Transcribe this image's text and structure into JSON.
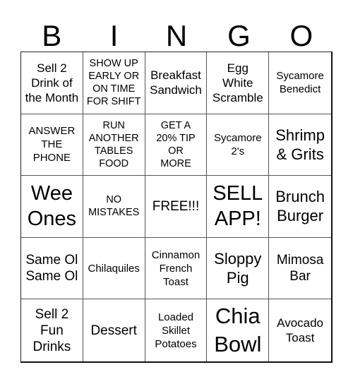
{
  "header": {
    "letters": [
      "B",
      "I",
      "N",
      "G",
      "O"
    ]
  },
  "board": {
    "cells": [
      "Sell 2\nDrink of\nthe Month",
      "SHOW UP\nEARLY OR\nON TIME\nFOR SHIFT",
      "Breakfast\nSandwich",
      "Egg\nWhite\nScramble",
      "Sycamore\nBenedict",
      "ANSWER\nTHE\nPHONE",
      "RUN\nANOTHER\nTABLES\nFOOD",
      "GET A\n20% TIP\nOR\nMORE",
      "Sycamore\n2's",
      "Shrimp\n& Grits",
      "Wee\nOnes",
      "NO\nMISTAKES",
      "FREE!!!",
      "SELL\nAPP!",
      "Brunch\nBurger",
      "Same Ol\nSame Ol",
      "Chilaquiles",
      "Cinnamon\nFrench\nToast",
      "Sloppy\nPig",
      "Mimosa\nBar",
      "Sell 2\nFun\nDrinks",
      "Dessert",
      "Loaded\nSkillet\nPotatoes",
      "Chia\nBowl",
      "Avocado\nToast"
    ]
  }
}
